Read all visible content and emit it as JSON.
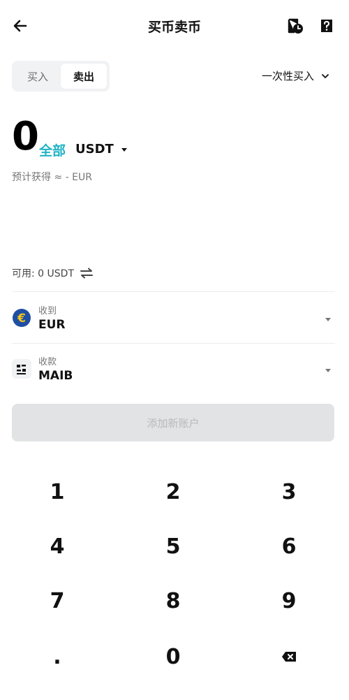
{
  "header": {
    "title": "买币卖币",
    "back_icon": "arrow-left-icon",
    "history_icon": "order-history-icon",
    "help_icon": "help-icon"
  },
  "mode": {
    "tabs": [
      "买入",
      "卖出"
    ],
    "selected": "卖出",
    "order_type": "一次性买入"
  },
  "amount": {
    "value": "0",
    "all_label": "全部",
    "currency": "USDT",
    "estimate": "预计获得 ≈ - EUR"
  },
  "available": {
    "text": "可用: 0 USDT",
    "swap_icon": "swap-icon"
  },
  "receive": {
    "label": "收到",
    "value": "EUR",
    "icon": "euro-icon"
  },
  "payment": {
    "label": "收款",
    "value": "MAIB",
    "icon": "bank-account-icon"
  },
  "add_account_label": "添加新账户",
  "keypad": {
    "keys": [
      "1",
      "2",
      "3",
      "4",
      "5",
      "6",
      "7",
      "8",
      "9",
      ".",
      "0"
    ],
    "backspace_icon": "backspace-icon"
  },
  "colors": {
    "accent": "#20b3c6",
    "euro_badge": "#1f4fa3",
    "euro_symbol": "#f5c518",
    "disabled_bg": "#e2e3e5"
  }
}
